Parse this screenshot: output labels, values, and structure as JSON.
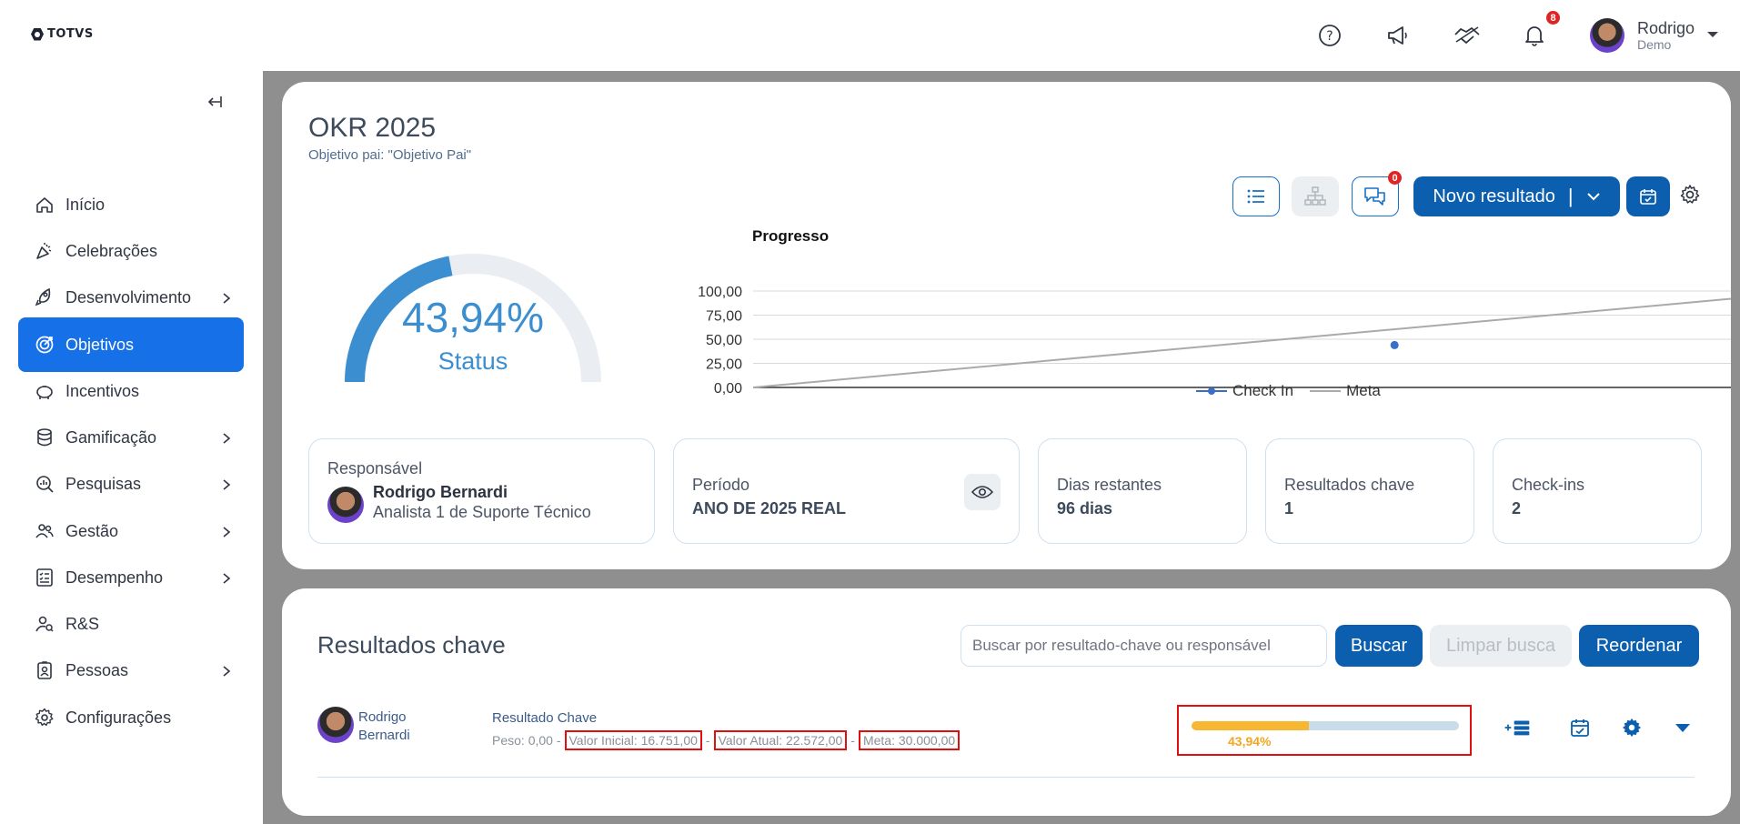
{
  "brand": {
    "logo_text": "TOTVS"
  },
  "topbar": {
    "icons": [
      "help-icon",
      "megaphone-icon",
      "handshake-icon",
      "bell-icon"
    ],
    "notification_count": "8",
    "user": {
      "name": "Rodrigo",
      "role": "Demo"
    }
  },
  "sidebar": {
    "items": [
      {
        "label": "Início",
        "icon": "home-icon",
        "has_children": false
      },
      {
        "label": "Celebrações",
        "icon": "party-icon",
        "has_children": false
      },
      {
        "label": "Desenvolvimento",
        "icon": "rocket-icon",
        "has_children": true
      },
      {
        "label": "Objetivos",
        "icon": "target-icon",
        "has_children": false,
        "active": true
      },
      {
        "label": "Incentivos",
        "icon": "piggy-bank-icon",
        "has_children": false
      },
      {
        "label": "Gamificação",
        "icon": "coins-icon",
        "has_children": true
      },
      {
        "label": "Pesquisas",
        "icon": "search-chart-icon",
        "has_children": true
      },
      {
        "label": "Gestão",
        "icon": "users-icon",
        "has_children": true
      },
      {
        "label": "Desempenho",
        "icon": "checklist-icon",
        "has_children": true
      },
      {
        "label": "R&S",
        "icon": "user-search-icon",
        "has_children": false
      },
      {
        "label": "Pessoas",
        "icon": "id-badge-icon",
        "has_children": true
      },
      {
        "label": "Configurações",
        "icon": "gear-icon",
        "has_children": false
      }
    ]
  },
  "okr": {
    "title": "OKR 2025",
    "subtitle": "Objetivo pai: \"Objetivo Pai\"",
    "comments_count": "0",
    "new_result_label": "Novo resultado",
    "status_value": "43,94%",
    "status_progress": 0.4394,
    "status_label": "Status",
    "accent": "#3b8fd0"
  },
  "chart_data": {
    "type": "line",
    "title": "Progresso",
    "ylim": [
      0,
      100
    ],
    "y_tick_labels": [
      "100,00",
      "75,00",
      "50,00",
      "25,00",
      "0,00"
    ],
    "series": [
      {
        "name": "Check In",
        "color": "#3a6fc9",
        "points": [
          [
            0.656,
            43.94
          ]
        ]
      },
      {
        "name": "Meta",
        "color": "#aaaaaa",
        "points": [
          [
            0,
            0
          ],
          [
            1,
            92
          ]
        ]
      }
    ]
  },
  "info": {
    "responsavel_label": "Responsável",
    "responsavel_name": "Rodrigo Bernardi",
    "responsavel_role": "Analista 1 de Suporte Técnico",
    "periodo_label": "Período",
    "periodo_value": "ANO DE 2025 REAL",
    "dias_label": "Dias restantes",
    "dias_value": "96 dias",
    "resultados_label": "Resultados chave",
    "resultados_value": "1",
    "checkins_label": "Check-ins",
    "checkins_value": "2"
  },
  "key_results": {
    "title": "Resultados chave",
    "search_placeholder": "Buscar por resultado-chave ou responsável",
    "buscar_label": "Buscar",
    "limpar_label": "Limpar busca",
    "reordenar_label": "Reordenar",
    "rows": [
      {
        "owner_first": "Rodrigo",
        "owner_last": "Bernardi",
        "name": "Resultado Chave",
        "peso": "Peso: 0,00",
        "valor_inicial": "Valor Inicial: 16.751,00",
        "valor_atual": "Valor Atual: 22.572,00",
        "meta": "Meta: 30.000,00",
        "progress_label": "43,94%",
        "progress": 0.4394
      }
    ]
  }
}
